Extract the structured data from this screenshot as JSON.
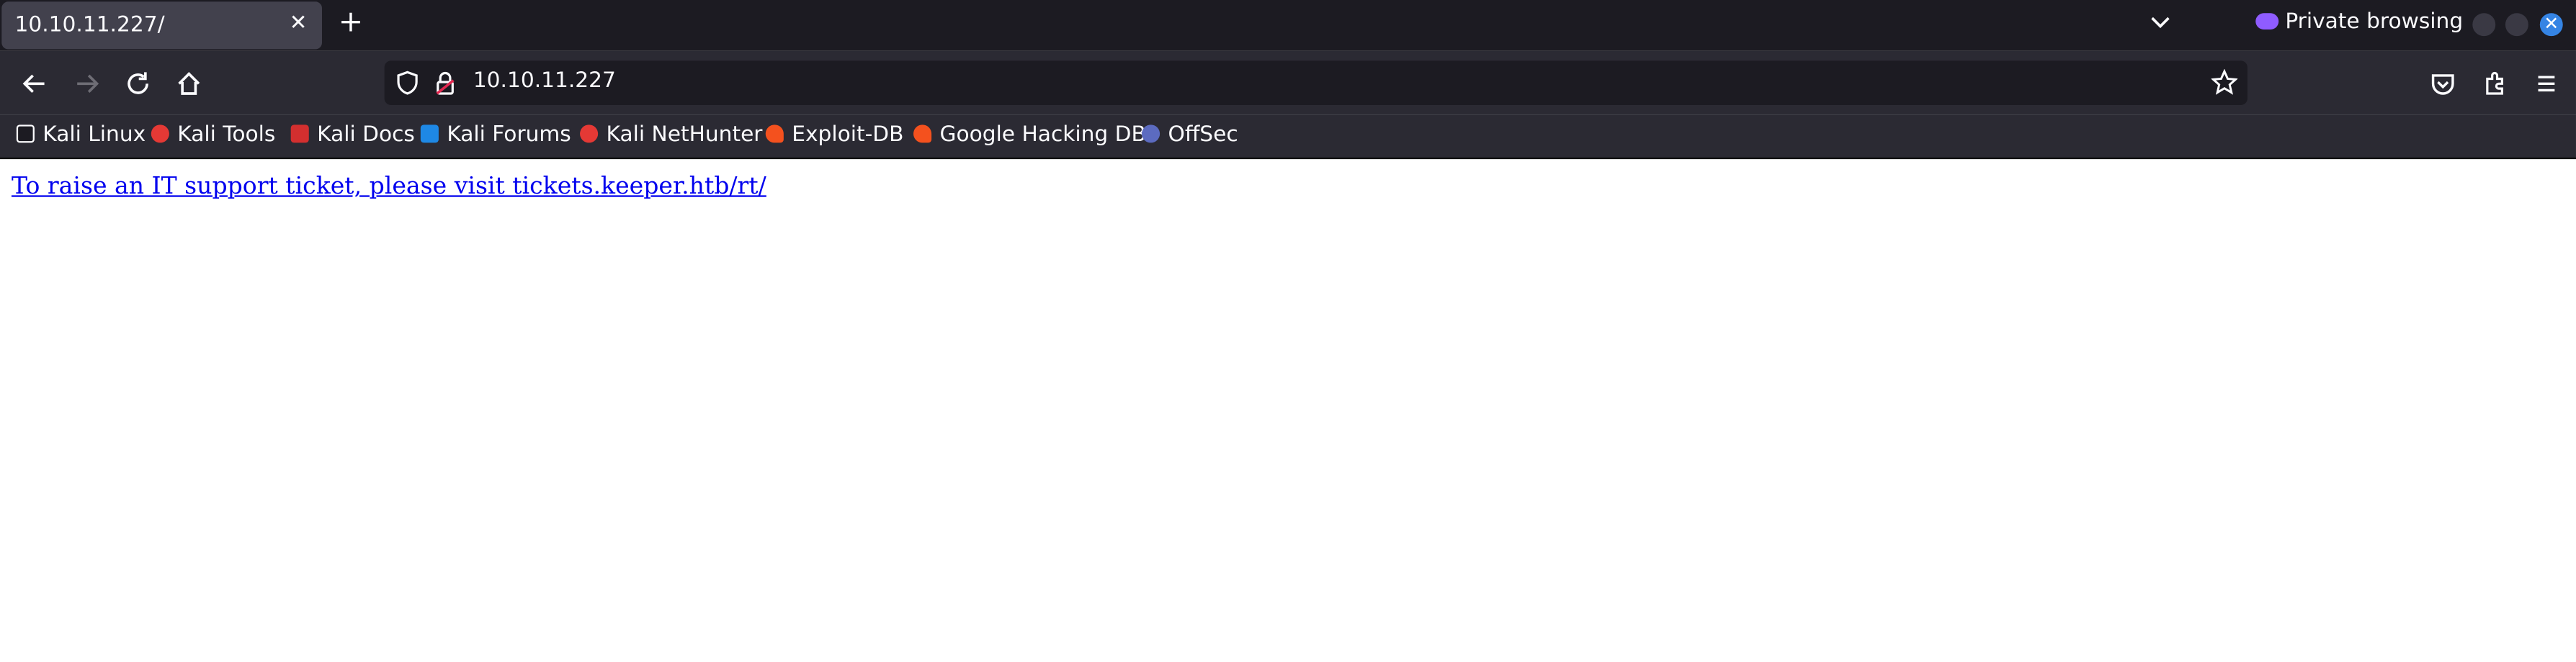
{
  "browser": {
    "tab": {
      "title": "10.10.11.227/",
      "close_label": "✕"
    },
    "new_tab_label": "+",
    "private_label": "Private browsing",
    "url": "10.10.11.227",
    "bookmarks": [
      {
        "label": "Kali Linux",
        "icon": "kali-dragon-icon",
        "color": "#1c1b22"
      },
      {
        "label": "Kali Tools",
        "icon": "kali-tools-icon",
        "color": "#e53935"
      },
      {
        "label": "Kali Docs",
        "icon": "kali-docs-icon",
        "color": "#d32f2f"
      },
      {
        "label": "Kali Forums",
        "icon": "kali-forums-icon",
        "color": "#1e88e5"
      },
      {
        "label": "Kali NetHunter",
        "icon": "kali-nethunter-icon",
        "color": "#e53935"
      },
      {
        "label": "Exploit-DB",
        "icon": "exploit-db-icon",
        "color": "#f4511e"
      },
      {
        "label": "Google Hacking DB",
        "icon": "google-hacking-db-icon",
        "color": "#f4511e"
      },
      {
        "label": "OffSec",
        "icon": "offsec-icon",
        "color": "#5c6bc0"
      }
    ]
  },
  "page": {
    "link_text": "To raise an IT support ticket, please visit tickets.keeper.htb/rt/"
  },
  "colors": {
    "tab_bar": "#1c1b22",
    "toolbar": "#2b2a33",
    "link": "#0000ee",
    "window_close": "#3584e4",
    "private_accent": "#8f5cff"
  }
}
